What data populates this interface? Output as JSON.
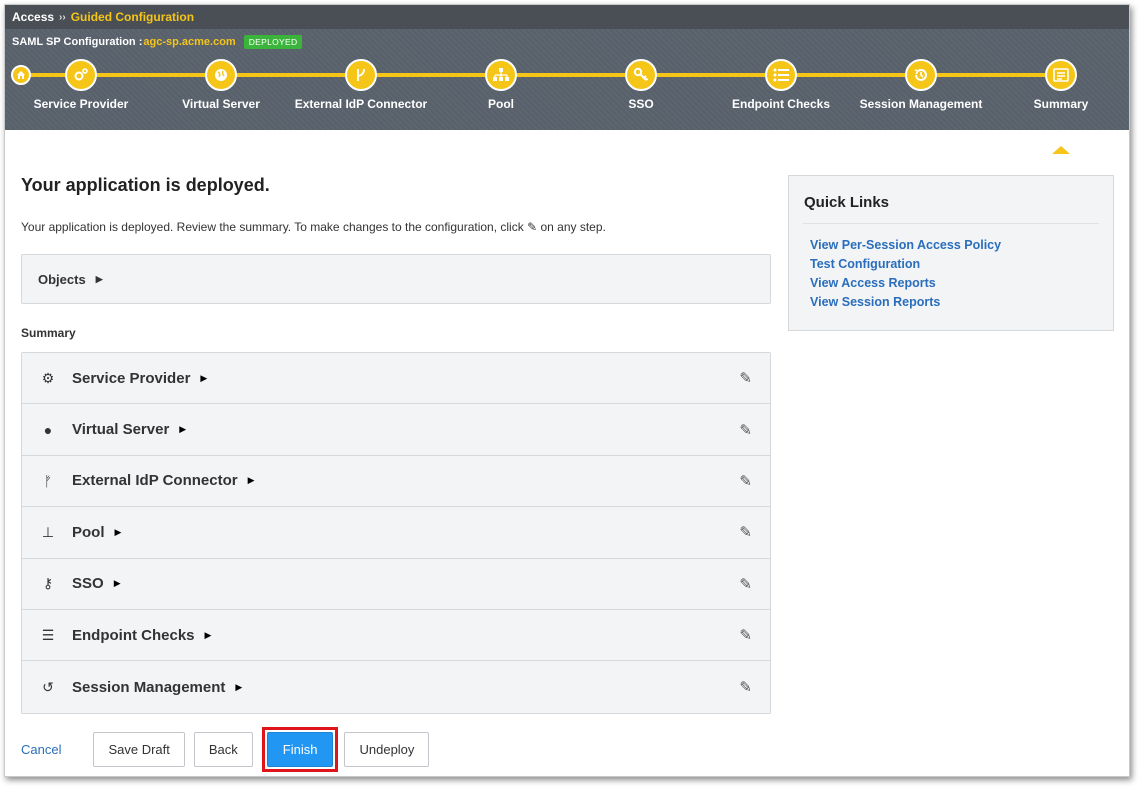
{
  "breadcrumb": {
    "root": "Access",
    "separator": "››",
    "current": "Guided Configuration"
  },
  "config": {
    "title": "SAML SP Configuration :",
    "host": "agc-sp.acme.com",
    "status": "DEPLOYED",
    "status_color": "#3bb43b"
  },
  "steps": [
    {
      "label": "Service Provider",
      "icon": "gears-icon"
    },
    {
      "label": "Virtual Server",
      "icon": "globe-icon"
    },
    {
      "label": "External IdP Connector",
      "icon": "fork-icon"
    },
    {
      "label": "Pool",
      "icon": "sitemap-icon"
    },
    {
      "label": "SSO",
      "icon": "key-icon"
    },
    {
      "label": "Endpoint Checks",
      "icon": "list-icon"
    },
    {
      "label": "Session Management",
      "icon": "history-icon"
    },
    {
      "label": "Summary",
      "icon": "summary-icon",
      "active": true
    }
  ],
  "main": {
    "heading": "Your application is deployed.",
    "desc_before": "Your application is deployed. Review the summary. To make changes to the configuration, click",
    "desc_after": "on any step.",
    "objects_label": "Objects",
    "summary_label": "Summary",
    "summary_items": [
      {
        "label": "Service Provider",
        "icon": "gears-icon"
      },
      {
        "label": "Virtual Server",
        "icon": "globe-icon"
      },
      {
        "label": "External IdP Connector",
        "icon": "fork-icon"
      },
      {
        "label": "Pool",
        "icon": "sitemap-icon"
      },
      {
        "label": "SSO",
        "icon": "key-icon"
      },
      {
        "label": "Endpoint Checks",
        "icon": "list-icon"
      },
      {
        "label": "Session Management",
        "icon": "history-icon"
      }
    ]
  },
  "quick_links": {
    "title": "Quick Links",
    "links": [
      "View Per-Session Access Policy",
      "Test Configuration",
      "View Access Reports",
      "View Session Reports"
    ]
  },
  "buttons": {
    "cancel": "Cancel",
    "save_draft": "Save Draft",
    "back": "Back",
    "finish": "Finish",
    "undeploy": "Undeploy"
  },
  "colors": {
    "accent": "#f5c518",
    "primary": "#2196f3",
    "link": "#2a6ebb",
    "highlight": "#e0141b"
  }
}
